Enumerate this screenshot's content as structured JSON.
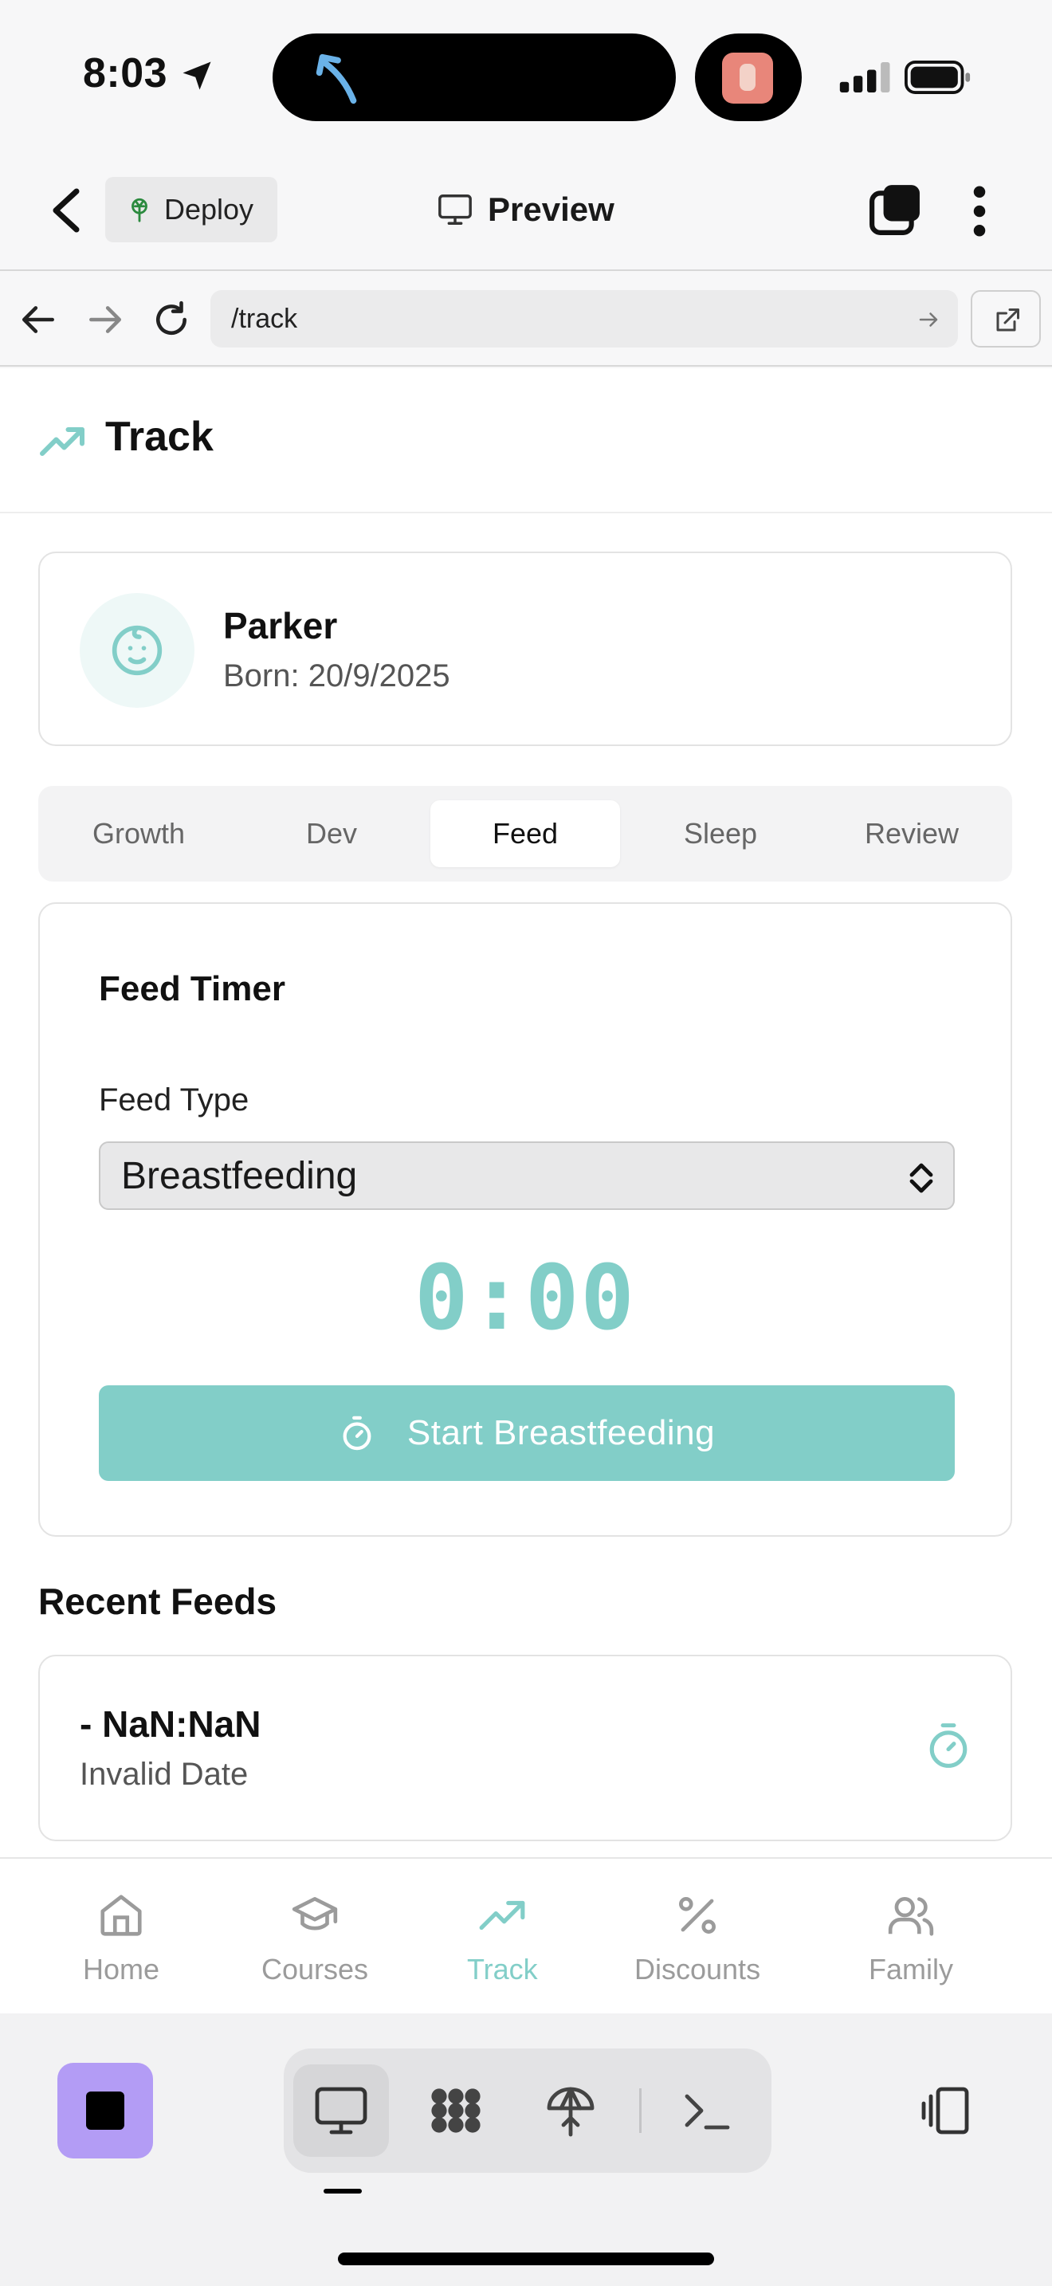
{
  "status_bar": {
    "time": "8:03"
  },
  "header": {
    "deploy_label": "Deploy",
    "preview_label": "Preview"
  },
  "browser": {
    "url": "/track"
  },
  "page": {
    "title": "Track"
  },
  "child": {
    "name": "Parker",
    "born": "Born: 20/9/2025"
  },
  "tabs": [
    {
      "label": "Growth",
      "active": false
    },
    {
      "label": "Dev",
      "active": false
    },
    {
      "label": "Feed",
      "active": true
    },
    {
      "label": "Sleep",
      "active": false
    },
    {
      "label": "Review",
      "active": false
    }
  ],
  "feed_timer": {
    "title": "Feed Timer",
    "feed_type_label": "Feed Type",
    "feed_type_value": "Breastfeeding",
    "elapsed": "0:00",
    "start_label": "Start Breastfeeding"
  },
  "recent": {
    "title": "Recent Feeds",
    "items": [
      {
        "duration": "- NaN:NaN",
        "date": "Invalid Date"
      }
    ]
  },
  "bottom_nav": [
    {
      "label": "Home",
      "icon": "home-icon",
      "active": false
    },
    {
      "label": "Courses",
      "icon": "graduation-cap-icon",
      "active": false
    },
    {
      "label": "Track",
      "icon": "trending-up-icon",
      "active": true
    },
    {
      "label": "Discounts",
      "icon": "percent-icon",
      "active": false
    },
    {
      "label": "Family",
      "icon": "users-icon",
      "active": false
    }
  ],
  "colors": {
    "accent": "#82cec8",
    "accent_light": "#eef8f7",
    "stop_button": "#b39cf5"
  }
}
